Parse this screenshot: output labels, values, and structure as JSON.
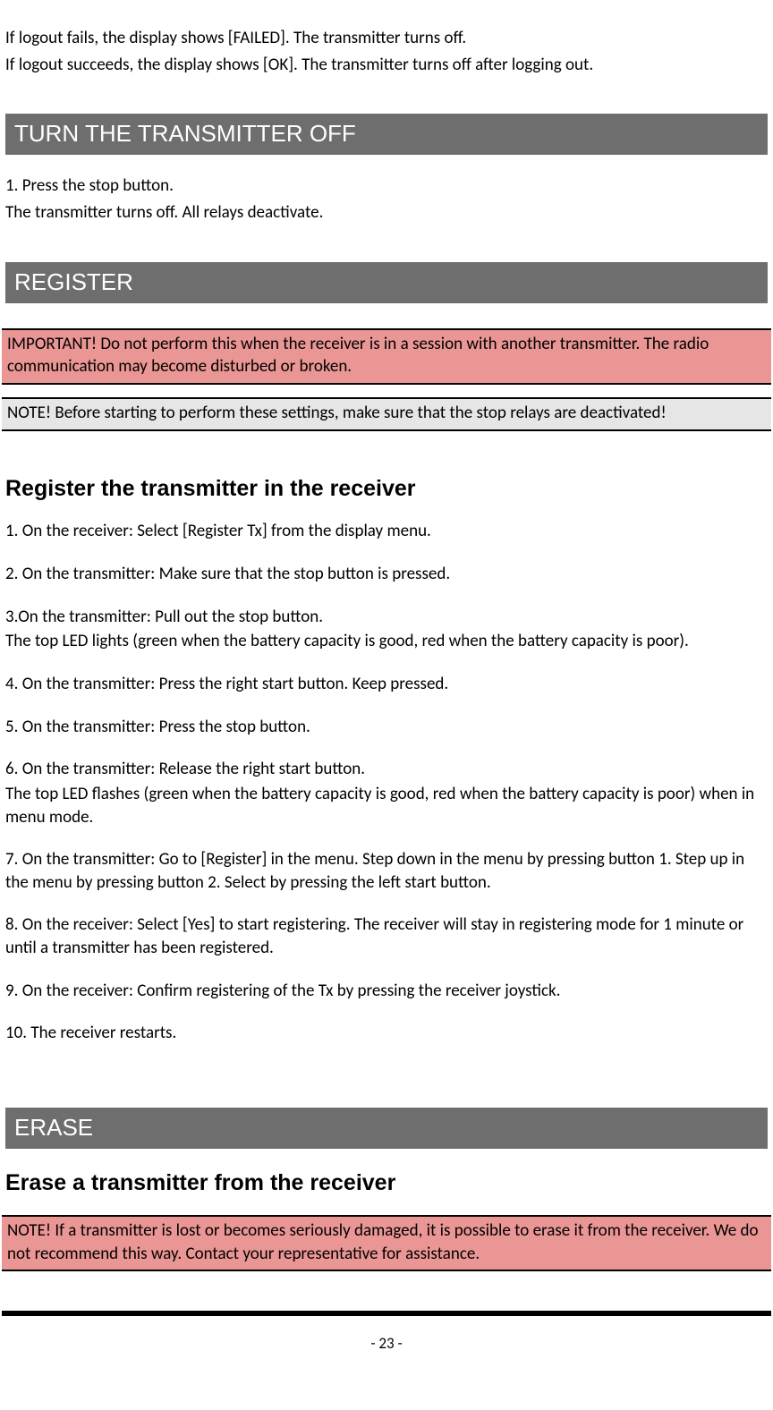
{
  "intro": {
    "line1": "If logout fails, the display shows [FAILED]. The transmitter turns off.",
    "line2": "If logout succeeds, the display shows [OK]. The transmitter turns off after logging out."
  },
  "turnOff": {
    "header": "TURN THE TRANSMITTER OFF",
    "step1": "1. Press the stop button.",
    "step1b": "The transmitter turns off. All relays deactivate."
  },
  "register": {
    "header": "REGISTER",
    "important": "IMPORTANT! Do not perform this when the receiver is in a session with another transmitter. The radio communication may become disturbed or broken.",
    "note": "NOTE! Before starting to perform these settings, make sure that the stop relays are deactivated!",
    "subheader": "Register the transmitter in the receiver",
    "steps": {
      "s1": "1. On the receiver: Select [Register Tx] from the display menu.",
      "s2": "2. On the transmitter: Make sure that the stop button is pressed.",
      "s3a": "3.On the transmitter: Pull out the stop button.",
      "s3b": "The top LED lights (green when the battery capacity is good, red when the battery capacity is poor).",
      "s4": "4. On the transmitter: Press the right start button. Keep pressed.",
      "s5": "5. On the transmitter: Press the stop button.",
      "s6a": "6. On the transmitter: Release the right start button.",
      "s6b": "The top LED flashes (green when the battery capacity is good, red when the battery capacity is poor) when in menu mode.",
      "s7": "7. On the transmitter: Go to [Register] in the menu. Step down in the menu by pressing button 1. Step up in the menu by pressing button 2. Select by pressing the left start button.",
      "s8": "8. On the receiver: Select [Yes] to start registering. The receiver will stay in registering mode for 1 minute or until a transmitter has been registered.",
      "s9": "9. On the receiver: Confirm registering of the Tx by pressing the receiver joystick.",
      "s10": "10. The receiver restarts."
    }
  },
  "erase": {
    "header": "ERASE",
    "subheader": "Erase a transmitter from the receiver",
    "note": "NOTE! If a transmitter is lost or becomes seriously damaged, it is possible to erase it from the receiver. We do not recommend this way. Contact your representative for assistance."
  },
  "pageNumber": "- 23 -"
}
